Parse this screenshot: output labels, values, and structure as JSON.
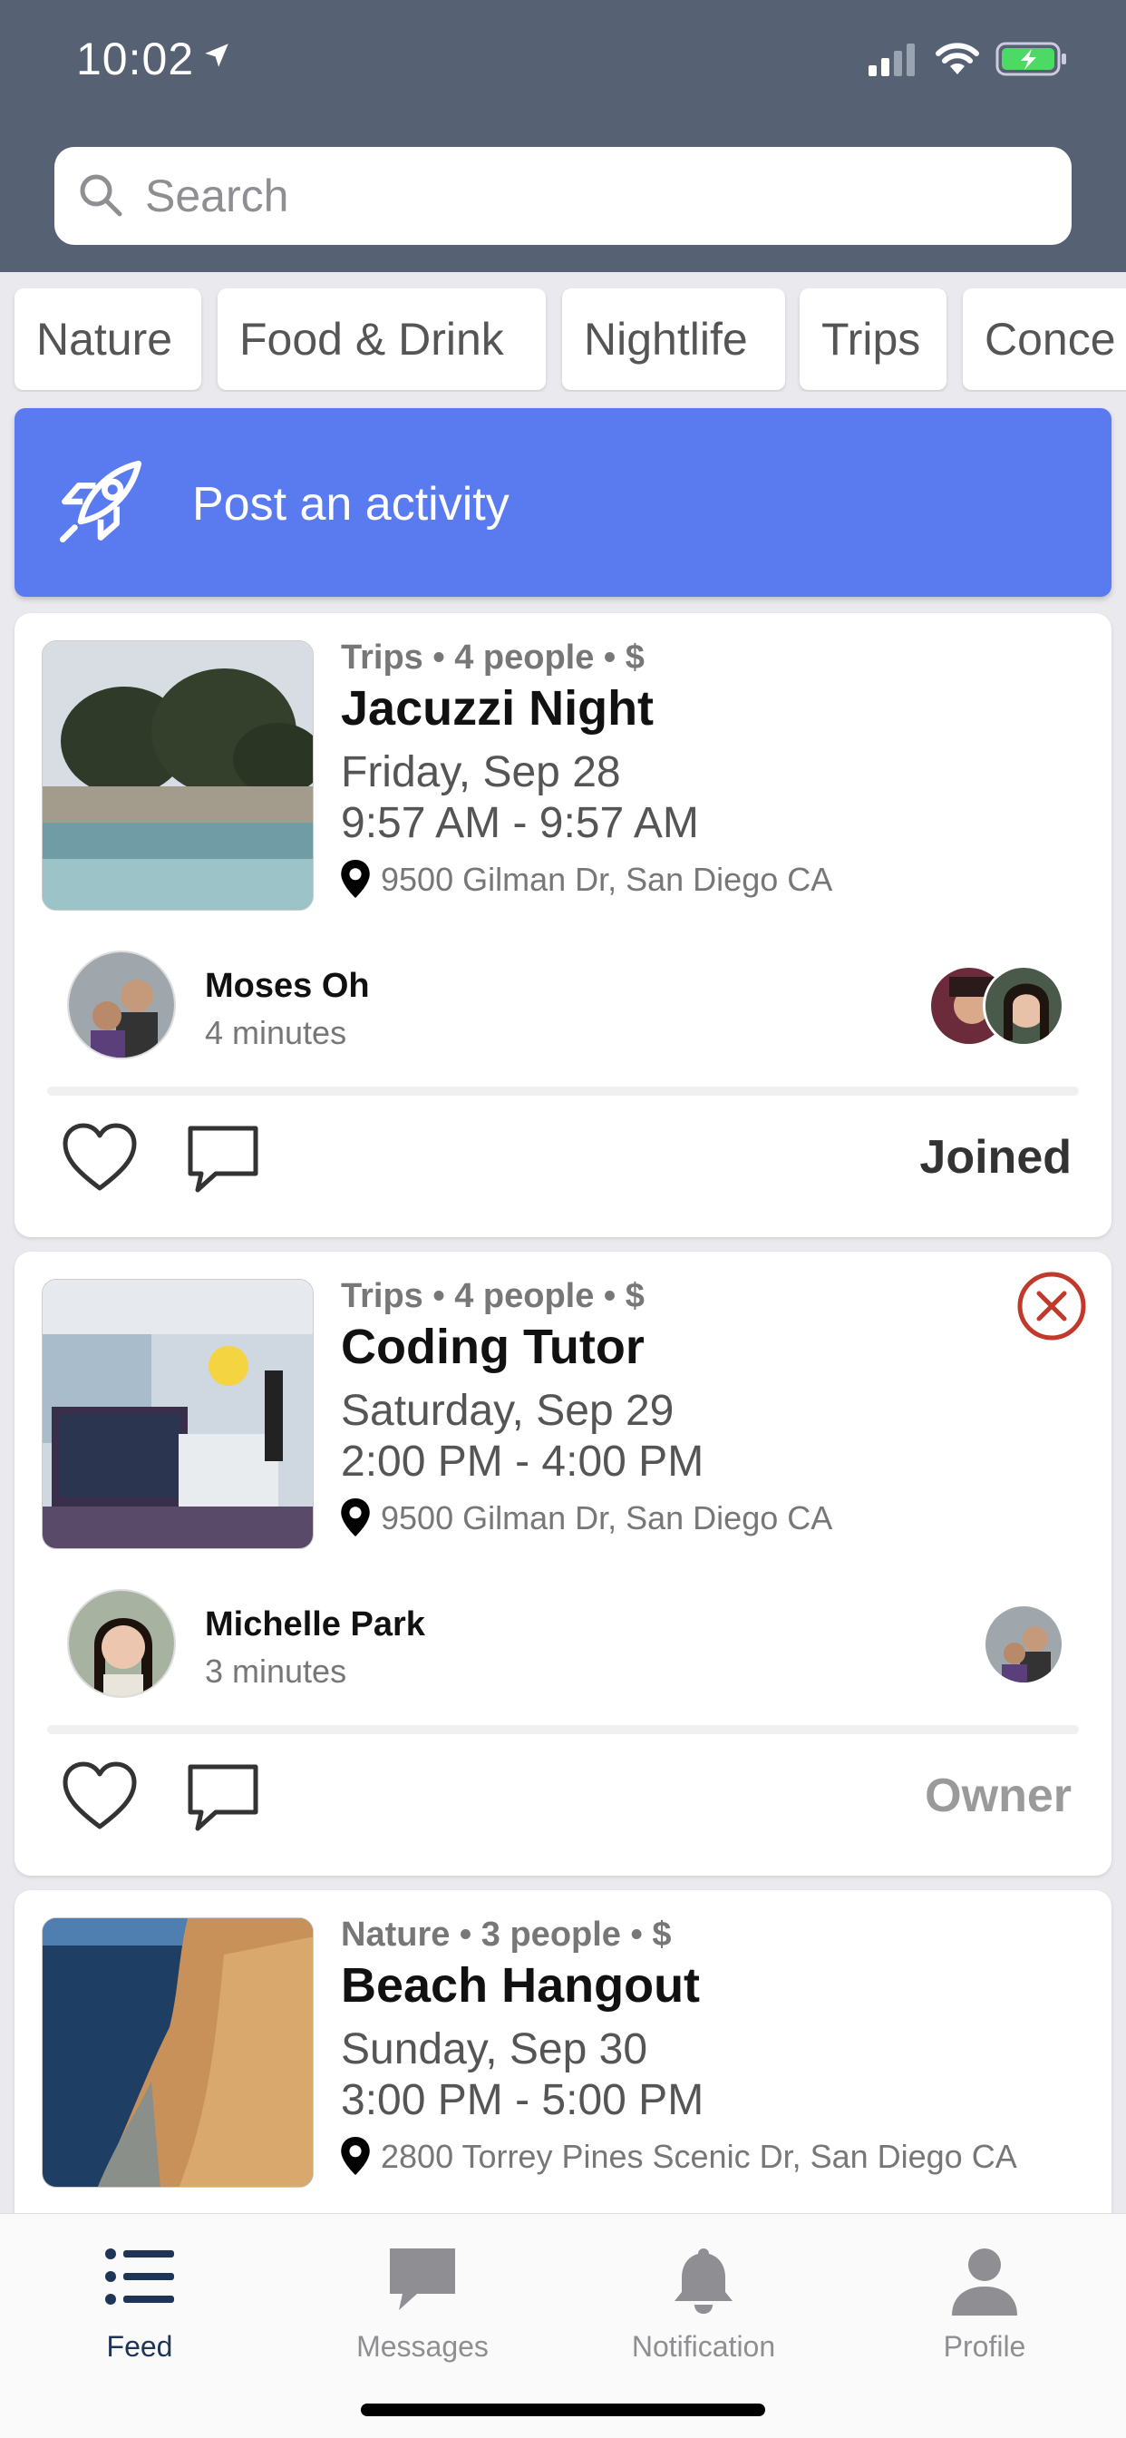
{
  "status_bar": {
    "time": "10:02"
  },
  "search": {
    "placeholder": "Search"
  },
  "categories": [
    "Nature",
    "Food & Drink",
    "Nightlife",
    "Trips",
    "Conce"
  ],
  "post_banner": {
    "label": "Post an activity"
  },
  "colors": {
    "header": "#566173",
    "accent": "#5a7bef",
    "cancel": "#c0392b",
    "tab_active": "#1f3558",
    "tab_inactive": "#8e8e93"
  },
  "activities": [
    {
      "meta": "Trips • 4 people • $",
      "title": "Jacuzzi Night",
      "date": "Friday, Sep 28",
      "time": "9:57 AM - 9:57 AM",
      "address": "9500 Gilman Dr, San Diego CA",
      "host_name": "Moses Oh",
      "posted": "4 minutes",
      "status": "Joined",
      "status_color": "#333333"
    },
    {
      "meta": "Trips • 4 people • $",
      "title": "Coding Tutor",
      "date": "Saturday, Sep 29",
      "time": "2:00 PM - 4:00 PM",
      "address": "9500 Gilman Dr, San Diego CA",
      "host_name": "Michelle Park",
      "posted": "3 minutes",
      "status": "Owner",
      "status_color": "#9a9a9a"
    },
    {
      "meta": "Nature • 3 people • $",
      "title": "Beach Hangout",
      "date": "Sunday, Sep 30",
      "time": "3:00 PM - 5:00 PM",
      "address": "2800 Torrey Pines Scenic Dr, San Diego CA"
    }
  ],
  "tabs": [
    {
      "label": "Feed",
      "icon": "list-icon",
      "active": true
    },
    {
      "label": "Messages",
      "icon": "chat-bubble-icon",
      "active": false
    },
    {
      "label": "Notification",
      "icon": "bell-icon",
      "active": false
    },
    {
      "label": "Profile",
      "icon": "person-icon",
      "active": false
    }
  ]
}
